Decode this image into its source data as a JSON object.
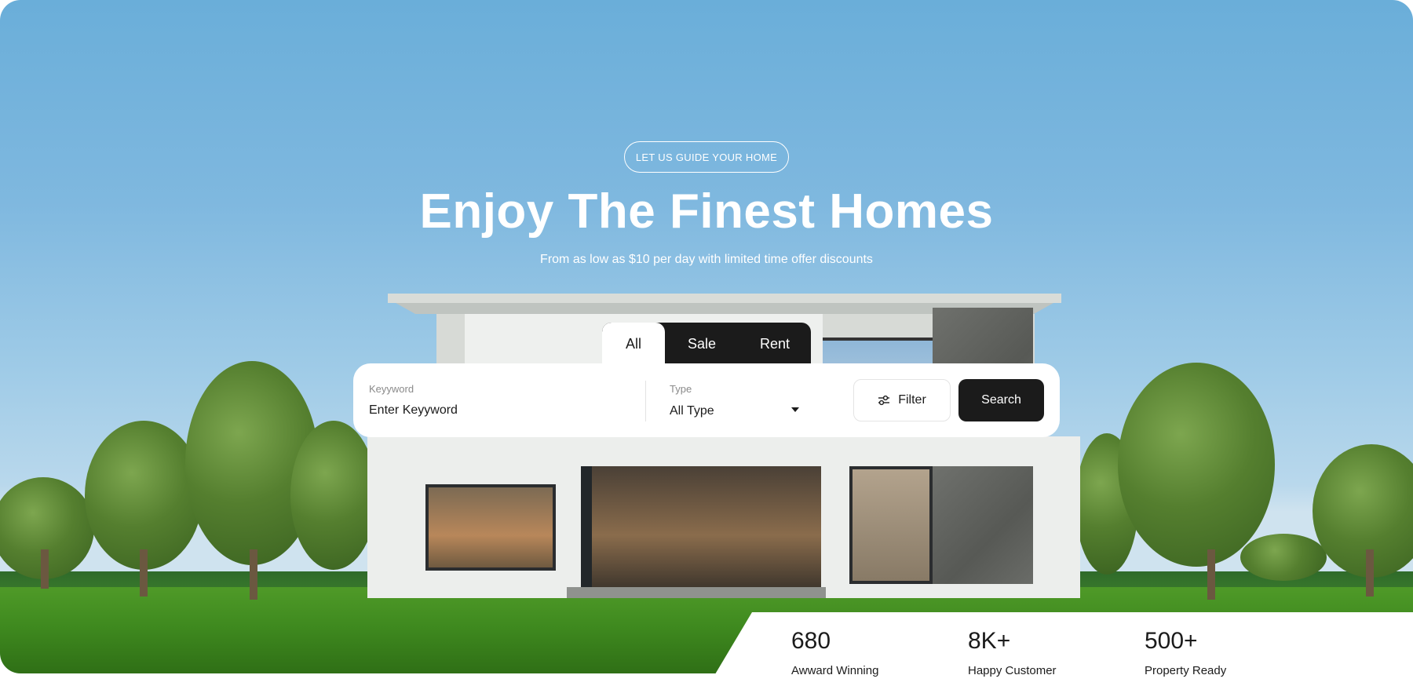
{
  "hero": {
    "badge": "LET US GUIDE YOUR HOME",
    "title": "Enjoy The Finest Homes",
    "subtitle": "From as low as $10 per day with limited time offer discounts"
  },
  "tabs": [
    {
      "label": "All",
      "active": true
    },
    {
      "label": "Sale",
      "active": false
    },
    {
      "label": "Rent",
      "active": false
    }
  ],
  "search": {
    "keyword_label": "Keyyword",
    "keyword_placeholder": "Enter Keyyword",
    "type_label": "Type",
    "type_value": "All Type",
    "filter_label": "Filter",
    "search_label": "Search"
  },
  "stats": [
    {
      "value": "680",
      "label": "Awward Winning"
    },
    {
      "value": "8K+",
      "label": "Happy Customer"
    },
    {
      "value": "500+",
      "label": "Property Ready"
    }
  ],
  "icons": {
    "filter": "sliders-icon",
    "dropdown": "caret-down-icon"
  },
  "colors": {
    "dark": "#1b1b1b",
    "white": "#ffffff",
    "sky": "#6aaed9"
  }
}
